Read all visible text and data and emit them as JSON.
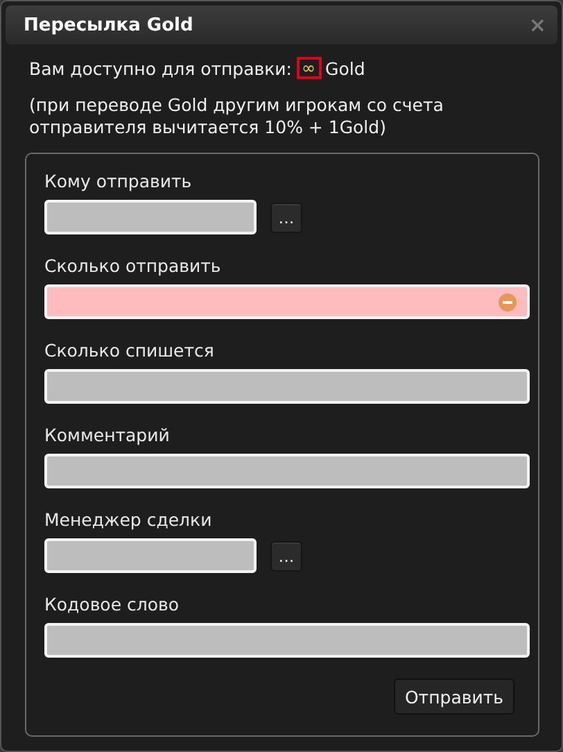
{
  "window": {
    "title": "Пересылка Gold",
    "close": "×"
  },
  "available": {
    "label": "Вам доступно для отправки:",
    "amount": "∞",
    "currency": "Gold"
  },
  "note": "(при переводе Gold другим игрокам со счета отправителя вычитается 10% + 1Gold)",
  "fields": [
    {
      "label": "Кому отправить",
      "kind": "picker",
      "invalid": false,
      "picker": "..."
    },
    {
      "label": "Сколько отправить",
      "kind": "full",
      "invalid": true
    },
    {
      "label": "Сколько спишется",
      "kind": "full",
      "invalid": false
    },
    {
      "label": "Комментарий",
      "kind": "full",
      "invalid": false
    },
    {
      "label": "Менеджер сделки",
      "kind": "picker",
      "invalid": false,
      "picker": "..."
    },
    {
      "label": "Кодовое слово",
      "kind": "full",
      "invalid": false
    }
  ],
  "submit": "Отправить"
}
